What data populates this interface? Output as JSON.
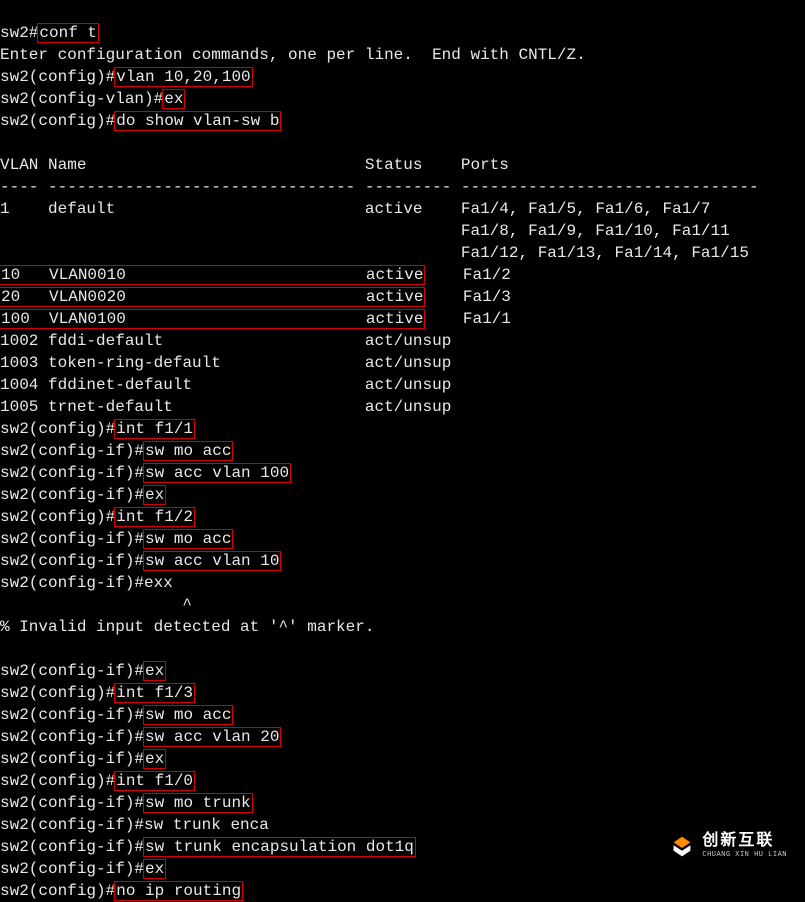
{
  "prompt": {
    "base": "sw2#",
    "config": "sw2(config)#",
    "config_vlan": "sw2(config-vlan)#",
    "config_if": "sw2(config-if)#"
  },
  "cmd": {
    "conf_t": "conf t",
    "vlan_create": "vlan 10,20,100",
    "ex": "ex",
    "do_show": "do show vlan-sw b",
    "int_f11": "int f1/1",
    "sw_mo_acc": "sw mo acc",
    "sw_acc_vlan100": "sw acc vlan 100",
    "int_f12": "int f1/2",
    "sw_acc_vlan10": "sw acc vlan 10",
    "exx": "exx",
    "int_f13": "int f1/3",
    "sw_acc_vlan20": "sw acc vlan 20",
    "int_f10": "int f1/0",
    "sw_mo_trunk": "sw mo trunk",
    "sw_trunk_enca": "sw trunk enca",
    "sw_trunk_encap_dot1q": "sw trunk encapsulation dot1q",
    "no_ip_routing": "no ip routing"
  },
  "msg": {
    "enter_conf": "Enter configuration commands, one per line.  End with CNTL/Z.",
    "caret_line": "                   ^",
    "invalid": "% Invalid input detected at '^' marker."
  },
  "table": {
    "hdr_vlan": "VLAN",
    "hdr_name": "Name",
    "hdr_status": "Status",
    "hdr_ports": "Ports",
    "sep1": "----",
    "sep2": "--------------------------------",
    "sep3": "---------",
    "sep4": "-------------------------------",
    "rows": {
      "r1_id": "1",
      "r1_name": "default",
      "r1_status": "active",
      "r1_ports1": "Fa1/4, Fa1/5, Fa1/6, Fa1/7",
      "r1_ports2": "Fa1/8, Fa1/9, Fa1/10, Fa1/11",
      "r1_ports3": "Fa1/12, Fa1/13, Fa1/14, Fa1/15",
      "r10_id": "10",
      "r10_name": "VLAN0010",
      "r10_status": "active",
      "r10_ports": "Fa1/2",
      "r20_id": "20",
      "r20_name": "VLAN0020",
      "r20_status": "active",
      "r20_ports": "Fa1/3",
      "r100_id": "100",
      "r100_name": "VLAN0100",
      "r100_status": "active",
      "r100_ports": "Fa1/1",
      "r1002_id": "1002",
      "r1002_name": "fddi-default",
      "r1002_status": "act/unsup",
      "r1003_id": "1003",
      "r1003_name": "token-ring-default",
      "r1003_status": "act/unsup",
      "r1004_id": "1004",
      "r1004_name": "fddinet-default",
      "r1004_status": "act/unsup",
      "r1005_id": "1005",
      "r1005_name": "trnet-default",
      "r1005_status": "act/unsup"
    }
  },
  "logo": {
    "cn": "创新互联",
    "en": "CHUANG XIN HU LIAN"
  }
}
